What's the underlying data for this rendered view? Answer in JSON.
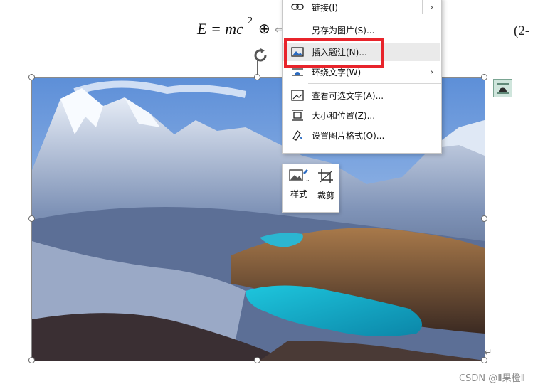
{
  "equation": {
    "lhs": "E = mc",
    "exponent": "2",
    "operator": "⊕",
    "arrow": "⇐",
    "number_fragment": "(2-"
  },
  "context_menu": {
    "items": [
      {
        "id": "link",
        "label": "链接(I)",
        "icon": "link-icon",
        "has_submenu": true
      },
      {
        "id": "save-as-picture",
        "label": "另存为图片(S)...",
        "icon": "",
        "has_submenu": false
      },
      {
        "id": "insert-caption",
        "label": "插入题注(N)...",
        "icon": "image-caption-icon",
        "has_submenu": false,
        "highlighted": true
      },
      {
        "id": "wrap-text",
        "label": "环绕文字(W)",
        "icon": "wrap-text-icon",
        "has_submenu": true
      },
      {
        "id": "view-alt-text",
        "label": "查看可选文字(A)...",
        "icon": "alt-text-icon",
        "has_submenu": false
      },
      {
        "id": "size-position",
        "label": "大小和位置(Z)...",
        "icon": "size-position-icon",
        "has_submenu": false
      },
      {
        "id": "format-picture",
        "label": "设置图片格式(O)...",
        "icon": "format-picture-icon",
        "has_submenu": false
      }
    ]
  },
  "mini_toolbar": {
    "style_label": "样式",
    "crop_label": "裁剪"
  },
  "paragraph_mark": "↵",
  "watermark": "CSDN @Ⅱ果橙Ⅱ",
  "colors": {
    "highlight_box": "#e8242b",
    "menu_hover": "#eaeaea",
    "lake": "#16a7c7",
    "sky": "#6e98d6"
  }
}
